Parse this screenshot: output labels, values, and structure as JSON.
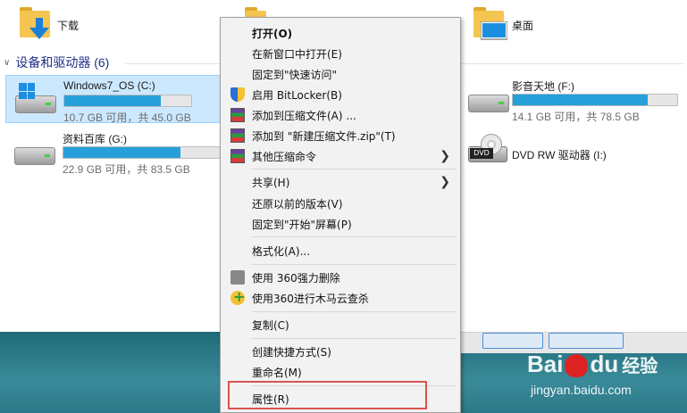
{
  "folders": [
    {
      "label": "下载",
      "icon": "download-folder-icon"
    },
    {
      "label": "",
      "icon": "folder-icon"
    },
    {
      "label": "桌面",
      "icon": "desktop-folder-icon"
    }
  ],
  "section": {
    "title": "设备和驱动器 (6)"
  },
  "drives": [
    {
      "name": "Windows7_OS (C:)",
      "size": "10.7 GB 可用，共 45.0 GB",
      "used_fraction": 0.76,
      "icon": "windows-drive-icon",
      "selected": true
    },
    {
      "name": "资料百库 (G:)",
      "size": "22.9 GB 可用，共 83.5 GB",
      "used_fraction": 0.73,
      "icon": "hard-drive-icon",
      "selected": false
    },
    {
      "name": "影音天地 (F:)",
      "size": "14.1 GB 可用，共 78.5 GB",
      "used_fraction": 0.82,
      "icon": "hard-drive-icon",
      "selected": false
    },
    {
      "name": "DVD RW 驱动器 (I:)",
      "size": "",
      "icon": "dvd-drive-icon",
      "selected": false
    }
  ],
  "dvd_tag": "DVD",
  "context_menu": {
    "items": [
      {
        "label": "打开(O)",
        "bold": true
      },
      {
        "label": "在新窗口中打开(E)"
      },
      {
        "label": "固定到\"快速访问\""
      },
      {
        "label": "启用 BitLocker(B)",
        "icon": "bitlocker-shield-icon"
      },
      {
        "label": "添加到压缩文件(A) ...",
        "icon": "winrar-icon"
      },
      {
        "label": "添加到 \"新建压缩文件.zip\"(T)",
        "icon": "winrar-icon"
      },
      {
        "label": "其他压缩命令",
        "icon": "winrar-icon",
        "submenu": true
      },
      {
        "label": "共享(H)",
        "submenu": true
      },
      {
        "label": "还原以前的版本(V)"
      },
      {
        "label": "固定到\"开始\"屏幕(P)"
      },
      {
        "label": "格式化(A)..."
      },
      {
        "label": "使用 360强力删除",
        "icon": "shredder-icon"
      },
      {
        "label": "使用360进行木马云查杀",
        "icon": "360-antivirus-icon"
      },
      {
        "label": "复制(C)"
      },
      {
        "label": "创建快捷方式(S)"
      },
      {
        "label": "重命名(M)"
      },
      {
        "label": "属性(R)"
      }
    ],
    "submenu_arrow": "❯"
  },
  "watermark": {
    "brand_left": "Bai",
    "brand_right": "du",
    "brand_cn": "经验",
    "url": "jingyan.baidu.com"
  },
  "colors": {
    "accent": "#26a0da",
    "selection": "#cce8ff",
    "highlight_box": "#d9534f",
    "section_title": "#1e3287"
  }
}
